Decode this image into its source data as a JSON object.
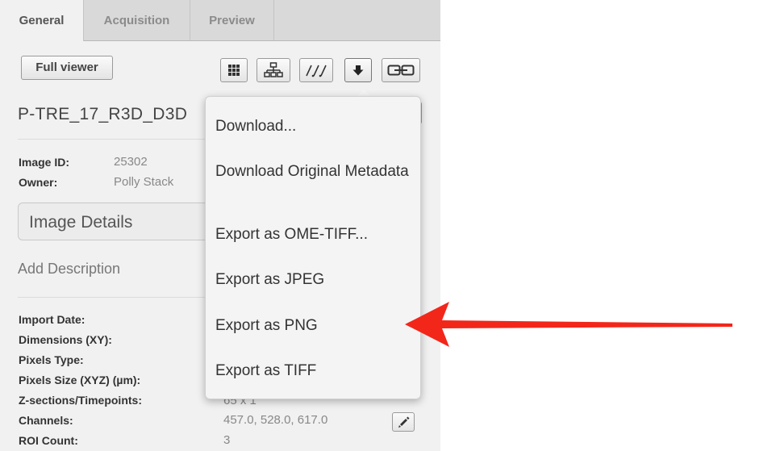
{
  "tabs": [
    {
      "label": "General",
      "active": true
    },
    {
      "label": "Acquisition",
      "active": false
    },
    {
      "label": "Preview",
      "active": false
    }
  ],
  "toolbar": {
    "full_viewer_label": "Full viewer",
    "icons": [
      "grid-icon",
      "hierarchy-icon",
      "link-path-icon",
      "download-icon",
      "chain-link-icon"
    ]
  },
  "image": {
    "name": "P-TRE_17_R3D_D3D"
  },
  "basic_meta": [
    {
      "label": "Image ID:",
      "value": "25302"
    },
    {
      "label": "Owner:",
      "value": "Polly Stack"
    }
  ],
  "details": {
    "title": "Image Details",
    "add_description": "Add Description"
  },
  "properties": [
    {
      "label": "Import Date:",
      "value": ""
    },
    {
      "label": "Dimensions (XY):",
      "value": ""
    },
    {
      "label": "Pixels Type:",
      "value": ""
    },
    {
      "label": "Pixels Size (XYZ) (µm):",
      "value": ""
    },
    {
      "label": "Z-sections/Timepoints:",
      "value": "65 x 1"
    },
    {
      "label": "Channels:",
      "value": "457.0, 528.0, 617.0"
    },
    {
      "label": "ROI Count:",
      "value": "3"
    }
  ],
  "download_menu": {
    "items": [
      "Download...",
      "Download Original Metadata",
      "Export as OME-TIFF...",
      "Export as JPEG",
      "Export as PNG",
      "Export as TIFF"
    ]
  },
  "colors": {
    "annotation_arrow": "#f3261a",
    "panel_bg": "#f1f1f1",
    "menu_bg": "#f4f4f4"
  }
}
